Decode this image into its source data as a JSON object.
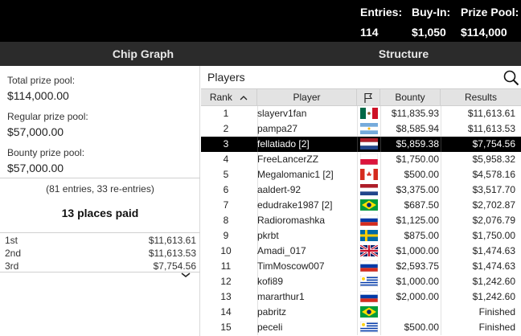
{
  "header": {
    "entries_label": "Entries:",
    "entries_value": "114",
    "buyin_label": "Buy-In:",
    "buyin_value": "$1,050",
    "prize_label": "Prize Pool:",
    "prize_value": "$114,000"
  },
  "tabs": {
    "chip_graph": "Chip Graph",
    "structure": "Structure"
  },
  "prize_pool": {
    "total_label": "Total prize pool:",
    "total_value": "$114,000.00",
    "regular_label": "Regular prize pool:",
    "regular_value": "$57,000.00",
    "bounty_label": "Bounty prize pool:",
    "bounty_value": "$57,000.00",
    "entries_note": "(81 entries, 33 re-entries)",
    "places_paid": "13 places paid"
  },
  "payouts": [
    {
      "place": "1st",
      "amount": "$11,613.61"
    },
    {
      "place": "2nd",
      "amount": "$11,613.53"
    },
    {
      "place": "3rd",
      "amount": "$7,754.56"
    }
  ],
  "players_table": {
    "title": "Players",
    "columns": {
      "rank": "Rank",
      "player": "Player",
      "bounty": "Bounty",
      "results": "Results"
    },
    "sort_indicator": "rank ascending",
    "rows": [
      {
        "rank": "1",
        "name": "slayerv1fan",
        "flag": "mexico",
        "bounty": "$11,835.93",
        "result": "$11,613.61",
        "selected": false
      },
      {
        "rank": "2",
        "name": "pampa27",
        "flag": "argentina",
        "bounty": "$8,585.94",
        "result": "$11,613.53",
        "selected": false
      },
      {
        "rank": "3",
        "name": "fellatiado [2]",
        "flag": "netherlands",
        "bounty": "$5,859.38",
        "result": "$7,754.56",
        "selected": true
      },
      {
        "rank": "4",
        "name": "FreeLancerZZ",
        "flag": "poland",
        "bounty": "$1,750.00",
        "result": "$5,958.32",
        "selected": false
      },
      {
        "rank": "5",
        "name": "Megalomanic1 [2]",
        "flag": "canada",
        "bounty": "$500.00",
        "result": "$4,578.16",
        "selected": false
      },
      {
        "rank": "6",
        "name": "aaldert-92",
        "flag": "netherlands",
        "bounty": "$3,375.00",
        "result": "$3,517.70",
        "selected": false
      },
      {
        "rank": "7",
        "name": "edudrake1987 [2]",
        "flag": "brazil",
        "bounty": "$687.50",
        "result": "$2,702.87",
        "selected": false
      },
      {
        "rank": "8",
        "name": "Radioromashka",
        "flag": "russia",
        "bounty": "$1,125.00",
        "result": "$2,076.79",
        "selected": false
      },
      {
        "rank": "9",
        "name": "pkrbt",
        "flag": "sweden",
        "bounty": "$875.00",
        "result": "$1,750.00",
        "selected": false
      },
      {
        "rank": "10",
        "name": "Amadi_017",
        "flag": "uk",
        "bounty": "$1,000.00",
        "result": "$1,474.63",
        "selected": false
      },
      {
        "rank": "11",
        "name": "TimMoscow007",
        "flag": "russia",
        "bounty": "$2,593.75",
        "result": "$1,474.63",
        "selected": false
      },
      {
        "rank": "12",
        "name": "kofi89",
        "flag": "uruguay",
        "bounty": "$1,000.00",
        "result": "$1,242.60",
        "selected": false
      },
      {
        "rank": "13",
        "name": "mararthur1",
        "flag": "russia",
        "bounty": "$2,000.00",
        "result": "$1,242.60",
        "selected": false
      },
      {
        "rank": "14",
        "name": "pabritz",
        "flag": "brazil",
        "bounty": "",
        "result": "Finished",
        "selected": false
      },
      {
        "rank": "15",
        "name": "peceli",
        "flag": "uruguay",
        "bounty": "$500.00",
        "result": "Finished",
        "selected": false
      }
    ]
  },
  "colors": {
    "topbar_bg": "#000000",
    "tabbar_bg": "#2b2b2b",
    "header_row_bg": "#e3e3e3",
    "selected_row_bg": "#000000"
  },
  "icons": {
    "search": "search-icon",
    "flag_column": "flag-icon",
    "sort": "sort-up-icon",
    "scroll": "chevron-down-icon"
  }
}
